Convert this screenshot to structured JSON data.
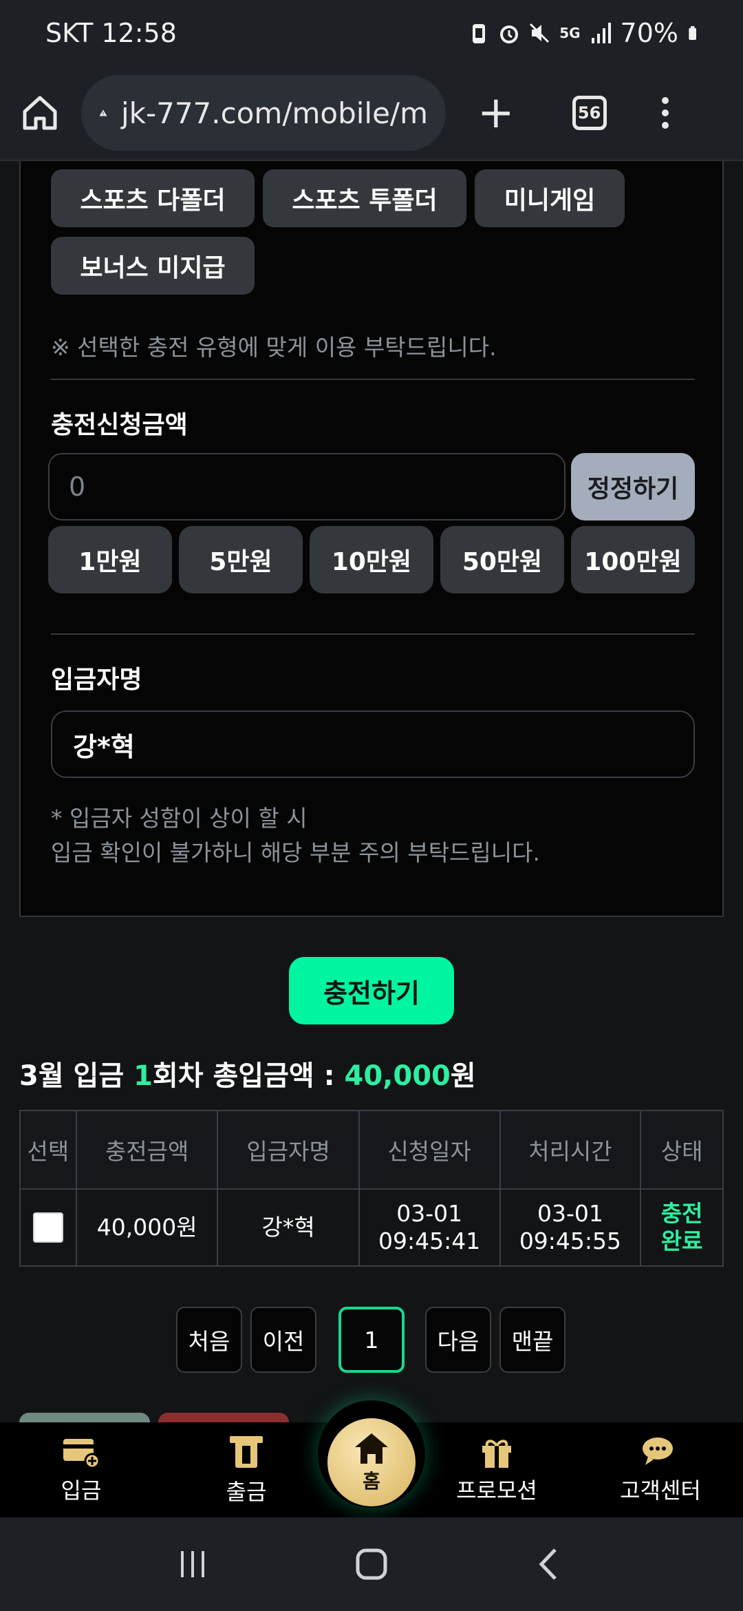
{
  "status_bar": {
    "carrier_time": "SKT 12:58",
    "network": "5G",
    "battery": "70%"
  },
  "browser": {
    "url": "jk-777.com/mobile/m",
    "tab_count": "56"
  },
  "charge_types": [
    "스포츠 다폴더",
    "스포츠 투폴더",
    "미니게임",
    "보너스 미지급"
  ],
  "type_notice": "※ 선택한 충전 유형에 맞게 이용 부탁드립니다.",
  "amount": {
    "label": "충전신청금액",
    "value": "0",
    "reset_label": "정정하기",
    "quick": [
      "1만원",
      "5만원",
      "10만원",
      "50만원",
      "100만원"
    ]
  },
  "depositor": {
    "label": "입금자명",
    "value": "강*혁",
    "hint_1": "* 입금자 성함이 상이 할 시",
    "hint_2": "입금 확인이 불가하니 해당 부분 주의 부탁드립니다."
  },
  "submit_label": "충전하기",
  "summary": {
    "prefix": "3월 입금 ",
    "count": "1",
    "middle": "회차 총입금액 : ",
    "total": "40,000",
    "suffix": "원"
  },
  "history": {
    "columns": [
      "선택",
      "충전금액",
      "입금자명",
      "신청일자",
      "처리시간",
      "상태"
    ],
    "rows": [
      {
        "amount": "40,000원",
        "name": "강*혁",
        "req_date": "03-01",
        "req_time": "09:45:41",
        "proc_date": "03-01",
        "proc_time": "09:45:55",
        "status_1": "충전",
        "status_2": "완료"
      }
    ]
  },
  "pager": {
    "first": "처음",
    "prev": "이전",
    "current": "1",
    "next": "다음",
    "last": "맨끝"
  },
  "tabs": {
    "deposit": "입금",
    "withdraw": "출금",
    "home": "홈",
    "promotion": "프로모션",
    "support": "고객센터"
  },
  "colors": {
    "accent": "#00f5a0",
    "gold": "#d9b45e",
    "panel_bg": "#050505"
  }
}
